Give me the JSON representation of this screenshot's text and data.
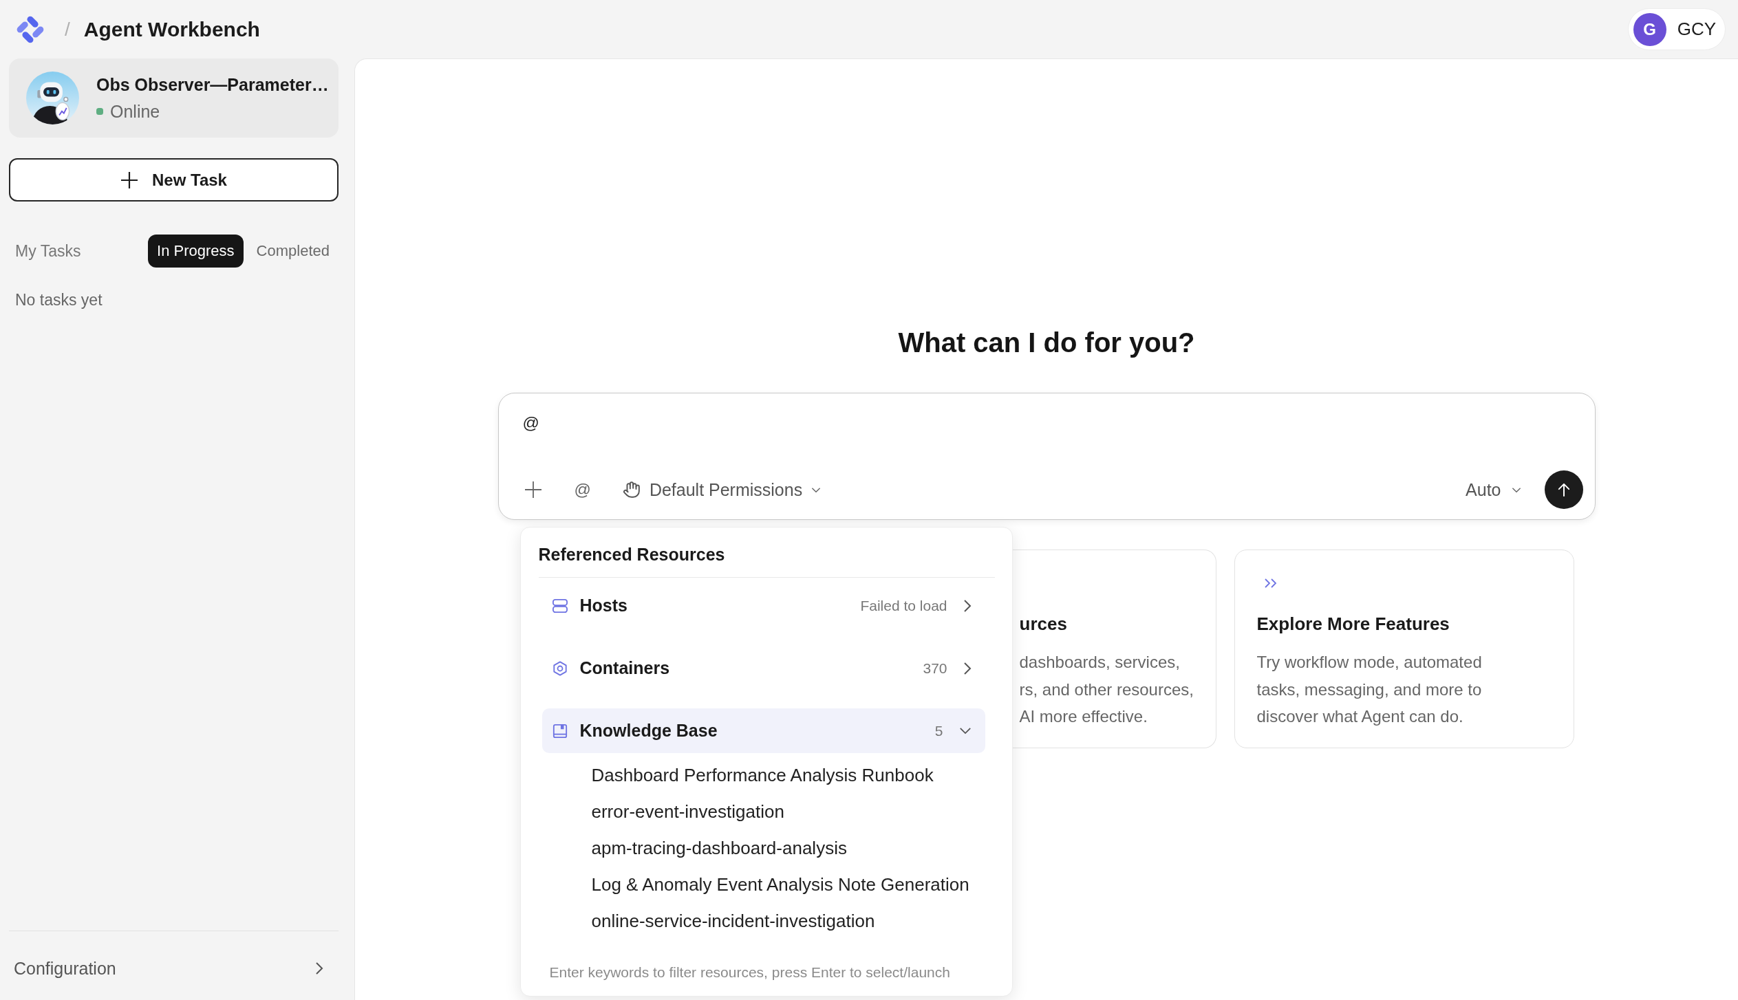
{
  "header": {
    "separator": "/",
    "title": "Agent Workbench",
    "user": {
      "initial": "G",
      "name": "GCY"
    }
  },
  "sidebar": {
    "agent": {
      "name": "Obs Observer—Parameter…",
      "status": "Online",
      "online": true
    },
    "new_task_button": "New Task",
    "tasks": {
      "label": "My Tasks",
      "tabs": [
        {
          "label": "In Progress",
          "selected": true
        },
        {
          "label": "Completed",
          "selected": false
        }
      ],
      "empty_text": "No tasks yet"
    },
    "footer": {
      "label": "Configuration"
    }
  },
  "main": {
    "heading": "What can I do for you?",
    "prompt": {
      "value": "@",
      "mention_button": "@",
      "permissions": "Default Permissions",
      "model": "Auto"
    },
    "resource_menu": {
      "title": "Referenced Resources",
      "categories": [
        {
          "kind": "hosts",
          "label": "Hosts",
          "meta": "Failed to load",
          "expanded": false,
          "selected": false
        },
        {
          "kind": "containers",
          "label": "Containers",
          "meta": "370",
          "expanded": false,
          "selected": false
        },
        {
          "kind": "knowledge",
          "label": "Knowledge Base",
          "meta": "5",
          "expanded": true,
          "selected": true,
          "children": [
            {
              "label": "Dashboard Performance Analysis Runbook"
            },
            {
              "label": "error-event-investigation"
            },
            {
              "label": "apm-tracing-dashboard-analysis"
            },
            {
              "label": "Log & Anomaly Event Analysis Note Generation"
            },
            {
              "label": "online-service-incident-investigation"
            }
          ]
        }
      ],
      "hint": "Enter keywords to filter resources, press Enter to select/launch"
    },
    "cards": [
      {
        "kind": "covered",
        "title": "urces",
        "description_lines": [
          "dashboards, services,",
          "rs, and other resources,",
          "AI more effective."
        ]
      },
      {
        "kind": "feature",
        "title": "Explore More Features",
        "description": "Try workflow mode, automated tasks, messaging, and more to discover what Agent can do."
      }
    ]
  }
}
